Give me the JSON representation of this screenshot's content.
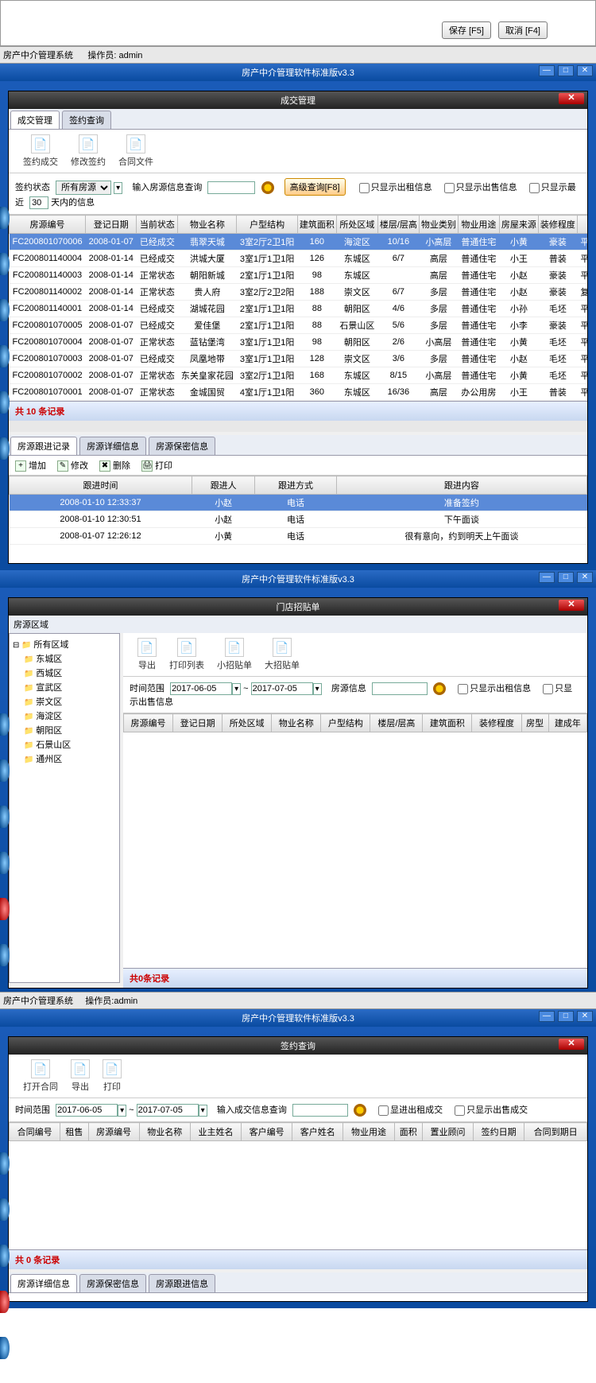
{
  "top_dialog": {
    "save": "保存 [F5]",
    "cancel": "取消 [F4]"
  },
  "status": {
    "app": "房产中介管理系统",
    "op_label": "操作员:",
    "op": "admin"
  },
  "app_title": "房产中介管理软件标准版v3.3",
  "win1": {
    "title": "成交管理",
    "tabs": [
      "成交管理",
      "签约查询"
    ],
    "tools": [
      {
        "name": "sign-deal",
        "label": "签约成交"
      },
      {
        "name": "modify-sign",
        "label": "修改签约"
      },
      {
        "name": "contract-file",
        "label": "合同文件"
      }
    ],
    "filter": {
      "status_label": "签约状态",
      "status_value": "所有房源",
      "search_label": "输入房源信息查询",
      "adv": "高级查询[F8]",
      "chk_rent": "只显示出租信息",
      "chk_sale": "只显示出售信息",
      "chk_recent_pre": "只显示最近",
      "chk_recent_days": "30",
      "chk_recent_post": "天内的信息"
    },
    "cols": [
      "房源编号",
      "登记日期",
      "当前状态",
      "物业名称",
      "户型结构",
      "建筑面积",
      "所处区域",
      "楼层/层高",
      "物业类别",
      "物业用途",
      "房屋来源",
      "装修程度",
      ""
    ],
    "rows": [
      [
        "FC200801070006",
        "2008-01-07",
        "已经成交",
        "翡翠天城",
        "3室2厅2卫1阳",
        "160",
        "海淀区",
        "10/16",
        "小高层",
        "普通住宅",
        "小黄",
        "豪装",
        "平层"
      ],
      [
        "FC200801140004",
        "2008-01-14",
        "已经成交",
        "洪城大厦",
        "3室1厅1卫1阳",
        "126",
        "东城区",
        "6/7",
        "高层",
        "普通住宅",
        "小王",
        "普装",
        "平层"
      ],
      [
        "FC200801140003",
        "2008-01-14",
        "正常状态",
        "朝阳新城",
        "2室1厅1卫1阳",
        "98",
        "东城区",
        "",
        "高层",
        "普通住宅",
        "小赵",
        "豪装",
        "平层"
      ],
      [
        "FC200801140002",
        "2008-01-14",
        "正常状态",
        "贵人府",
        "3室2厅2卫2阳",
        "188",
        "崇文区",
        "6/7",
        "多层",
        "普通住宅",
        "小赵",
        "豪装",
        "复式"
      ],
      [
        "FC200801140001",
        "2008-01-14",
        "已经成交",
        "湖城花园",
        "2室1厅1卫1阳",
        "88",
        "朝阳区",
        "4/6",
        "多层",
        "普通住宅",
        "小孙",
        "毛坯",
        "平层"
      ],
      [
        "FC200801070005",
        "2008-01-07",
        "已经成交",
        "爱佳堡",
        "2室1厅1卫1阳",
        "88",
        "石景山区",
        "5/6",
        "多层",
        "普通住宅",
        "小李",
        "豪装",
        "平层"
      ],
      [
        "FC200801070004",
        "2008-01-07",
        "正常状态",
        "蓝钻堡湾",
        "3室1厅1卫1阳",
        "98",
        "朝阳区",
        "2/6",
        "小高层",
        "普通住宅",
        "小黄",
        "毛坯",
        "平层"
      ],
      [
        "FC200801070003",
        "2008-01-07",
        "已经成交",
        "凤凰地带",
        "3室1厅1卫1阳",
        "128",
        "崇文区",
        "3/6",
        "多层",
        "普通住宅",
        "小赵",
        "毛坯",
        "平层"
      ],
      [
        "FC200801070002",
        "2008-01-07",
        "正常状态",
        "东关皇家花园",
        "3室2厅1卫1阳",
        "168",
        "东城区",
        "8/15",
        "小高层",
        "普通住宅",
        "小黄",
        "毛坯",
        "平层"
      ],
      [
        "FC200801070001",
        "2008-01-07",
        "正常状态",
        "金城国贸",
        "4室1厅1卫1阳",
        "360",
        "东城区",
        "16/36",
        "高层",
        "办公用房",
        "小王",
        "普装",
        "平层"
      ]
    ],
    "footer": "共 10 条记录",
    "sub_tabs": [
      "房源跟进记录",
      "房源详细信息",
      "房源保密信息"
    ],
    "sub_tools": [
      {
        "n": "add",
        "l": "增加",
        "c": "+"
      },
      {
        "n": "edit",
        "l": "修改",
        "c": "✎"
      },
      {
        "n": "del",
        "l": "删除",
        "c": "✖"
      },
      {
        "n": "print",
        "l": "打印",
        "c": "🖨"
      }
    ],
    "sub_cols": [
      "跟进时间",
      "跟进人",
      "跟进方式",
      "跟进内容"
    ],
    "sub_rows": [
      [
        "2008-01-10 12:33:37",
        "小赵",
        "电话",
        "准备签约"
      ],
      [
        "2008-01-10 12:30:51",
        "小赵",
        "电话",
        "下午面谈"
      ],
      [
        "2008-01-07 12:26:12",
        "小黄",
        "电话",
        "很有意向，约到明天上午面谈"
      ]
    ]
  },
  "win2": {
    "title": "门店招贴单",
    "tree_label": "房源区域",
    "tree_root": "所有区域",
    "tree_nodes": [
      "东城区",
      "西城区",
      "宣武区",
      "崇文区",
      "海淀区",
      "朝阳区",
      "石景山区",
      "通州区"
    ],
    "tools": [
      {
        "name": "export",
        "label": "导出"
      },
      {
        "name": "print-list",
        "label": "打印列表"
      },
      {
        "name": "small-poster",
        "label": "小招贴单"
      },
      {
        "name": "big-poster",
        "label": "大招贴单"
      }
    ],
    "filter": {
      "range_label": "时间范围",
      "date_from": "2017-06-05",
      "date_to": "2017-07-05",
      "info_label": "房源信息",
      "chk_rent": "只显示出租信息",
      "chk_sale": "只显示出售信息"
    },
    "cols": [
      "房源编号",
      "登记日期",
      "所处区域",
      "物业名称",
      "户型结构",
      "楼层/层高",
      "建筑面积",
      "装修程度",
      "房型",
      "建成年"
    ],
    "footer": "共0条记录"
  },
  "status2": {
    "app": "房产中介管理系统",
    "op_label": "操作员:",
    "op": "admin"
  },
  "win3": {
    "title": "签约查询",
    "tools": [
      {
        "name": "open-contract",
        "label": "打开合同"
      },
      {
        "name": "export",
        "label": "导出"
      },
      {
        "name": "print",
        "label": "打印"
      }
    ],
    "filter": {
      "range_label": "时间范围",
      "date_from": "2017-06-05",
      "date_to": "2017-07-05",
      "search_label": "输入成交信息查询",
      "chk_rent": "显进出租成交",
      "chk_sale": "只显示出售成交"
    },
    "cols": [
      "合同编号",
      "租售",
      "房源编号",
      "物业名称",
      "业主姓名",
      "客户编号",
      "客户姓名",
      "物业用途",
      "面积",
      "置业顾问",
      "签约日期",
      "合同到期日"
    ],
    "footer": "共 0 条记录",
    "sub_tabs": [
      "房源详细信息",
      "房源保密信息",
      "房源跟进信息"
    ]
  }
}
